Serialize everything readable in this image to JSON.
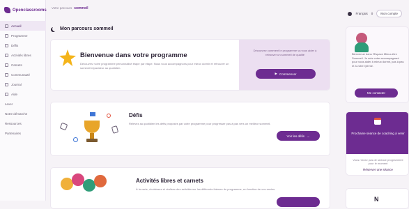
{
  "app": {
    "logo_text": "Openclassrooms"
  },
  "sidebar": {
    "items": [
      {
        "label": "Accueil",
        "icon": "home-icon",
        "active": true
      },
      {
        "label": "Programme",
        "icon": "program-icon"
      },
      {
        "label": "Défis",
        "icon": "target-icon"
      },
      {
        "label": "Activités libres",
        "icon": "activity-icon"
      },
      {
        "label": "Carnets",
        "icon": "notebook-icon"
      },
      {
        "label": "Communauté",
        "icon": "community-icon"
      },
      {
        "label": "Journal",
        "icon": "journal-icon"
      },
      {
        "label": "Aide",
        "icon": "help-icon"
      }
    ],
    "extra": [
      "Lever",
      "Notre démarche",
      "Ressources",
      "Partenaires"
    ]
  },
  "topbar": {
    "crumb_prefix": "Votre parcours",
    "crumb_bold": "sommeil",
    "lang": "Français",
    "notifications": "0",
    "user": "Mon compte"
  },
  "page_title": "Mon parcours sommeil",
  "welcome": {
    "title": "Bienvenue dans votre programme",
    "body": "Découvrez votre programme personnalisé étape par étape. Nous vous accompagnons pour mieux dormir et retrouver un sommeil réparateur au quotidien.",
    "side_text": "Découvrez comment le programme va vous aider à retrouver un sommeil de qualité",
    "button": "Commencer"
  },
  "defis": {
    "title": "Défis",
    "body": "Relevez au quotidien les défis proposés par votre programme pour progresser pas à pas vers un meilleur sommeil.",
    "button": "Voir les défis"
  },
  "activities": {
    "title": "Activités libres et carnets",
    "body": "À la carte, choisissez et réalisez des activités sur les différents thèmes du programme, en fonction de vos envies."
  },
  "right": {
    "coach_text": "Bienvenue dans l'Espace Mieux-être Sommeil. Je suis votre accompagnant pour vous aider à mieux dormir, pas à pas et à votre rythme.",
    "coach_button": "Me contacter",
    "session_title": "Prochaine séance de coaching à venir",
    "session_sub": "Vous n'avez pas de séance programmée pour le moment",
    "session_link": "Réserver une séance",
    "bottom_letter": "N"
  },
  "colors": {
    "accent": "#6d2c91",
    "accent_light": "#ecdff1",
    "star": "#f4b41a"
  }
}
